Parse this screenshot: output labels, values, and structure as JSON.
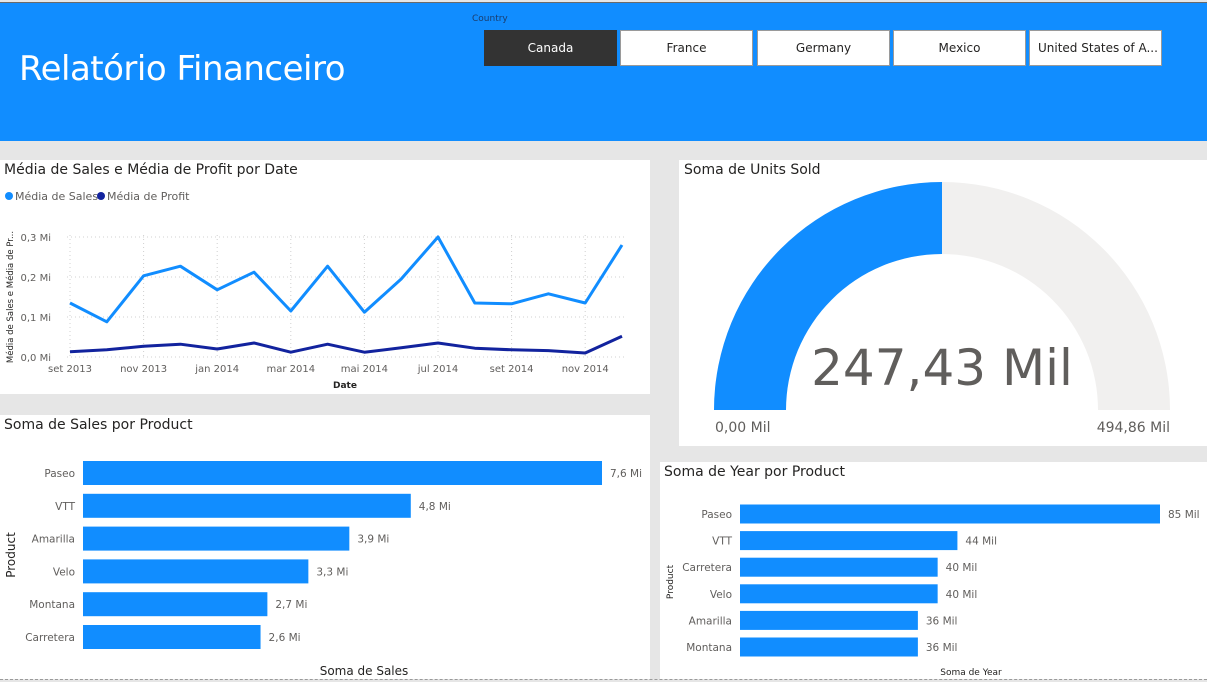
{
  "header": {
    "title": "Relatório Financeiro",
    "slicer_label": "Country",
    "options": [
      {
        "label": "Canada",
        "selected": true
      },
      {
        "label": "France",
        "selected": false
      },
      {
        "label": "Germany",
        "selected": false
      },
      {
        "label": "Mexico",
        "selected": false
      },
      {
        "label": "United States of A...",
        "selected": false
      }
    ]
  },
  "colors": {
    "header_bg": "#118dff",
    "series_sales": "#118dff",
    "series_profit": "#12239e",
    "gauge_fill": "#118dff",
    "gauge_track": "#f1f0ef",
    "selected_button": "#333333"
  },
  "line_panel": {
    "title": "Média de Sales e Média de Profit por Date"
  },
  "gauge_panel": {
    "title": "Soma de Units Sold",
    "value_label": "247,43 Mil",
    "min_label": "0,00 Mil",
    "max_label": "494,86 Mil"
  },
  "sales_panel": {
    "title": "Soma de Sales por Product"
  },
  "year_panel": {
    "title": "Soma de Year por Product"
  },
  "chart_data": [
    {
      "type": "line",
      "title": "Média de Sales e Média de Profit por Date",
      "xlabel": "Date",
      "ylabel": "Média de Sales e Média de Pr...",
      "x": [
        "set 2013",
        "out 2013",
        "nov 2013",
        "dez 2013",
        "jan 2014",
        "fev 2014",
        "mar 2014",
        "abr 2014",
        "mai 2014",
        "jun 2014",
        "jul 2014",
        "ago 2014",
        "set 2014",
        "out 2014",
        "nov 2014",
        "dez 2014"
      ],
      "x_tick_labels": [
        "set 2013",
        "nov 2013",
        "jan 2014",
        "mar 2014",
        "mai 2014",
        "jul 2014",
        "set 2014",
        "nov 2014"
      ],
      "y_tick_labels": [
        "0,0 Mi",
        "0,1 Mi",
        "0,2 Mi",
        "0,3 Mi"
      ],
      "ylim": [
        0,
        0.3
      ],
      "legend_position": "top-left",
      "series": [
        {
          "name": "Média de  Sales",
          "values": [
            0.135,
            0.088,
            0.203,
            0.227,
            0.168,
            0.212,
            0.115,
            0.227,
            0.112,
            0.195,
            0.3,
            0.135,
            0.133,
            0.158,
            0.135,
            0.28
          ]
        },
        {
          "name": "Média de Profit",
          "values": [
            0.013,
            0.018,
            0.027,
            0.032,
            0.02,
            0.035,
            0.012,
            0.032,
            0.012,
            0.023,
            0.035,
            0.022,
            0.018,
            0.016,
            0.01,
            0.052
          ]
        }
      ]
    },
    {
      "type": "gauge",
      "title": "Soma de Units Sold",
      "value": 247.43,
      "min": 0,
      "max": 494.86,
      "unit": "Mil"
    },
    {
      "type": "bar",
      "orientation": "horizontal",
      "title": "Soma de Sales por Product",
      "xlabel": "Soma de Sales",
      "ylabel": "Product",
      "categories": [
        "Paseo",
        "VTT",
        "Amarilla",
        "Velo",
        "Montana",
        "Carretera"
      ],
      "values": [
        7.6,
        4.8,
        3.9,
        3.3,
        2.7,
        2.6
      ],
      "data_labels": [
        "7,6 Mi",
        "4,8 Mi",
        "3,9 Mi",
        "3,3 Mi",
        "2,7 Mi",
        "2,6 Mi"
      ]
    },
    {
      "type": "bar",
      "orientation": "horizontal",
      "title": "Soma de Year por Product",
      "xlabel": "Soma de Year",
      "ylabel": "Product",
      "categories": [
        "Paseo",
        "VTT",
        "Carretera",
        "Velo",
        "Amarilla",
        "Montana"
      ],
      "values": [
        85,
        44,
        40,
        40,
        36,
        36
      ],
      "data_labels": [
        "85 Mil",
        "44 Mil",
        "40 Mil",
        "40 Mil",
        "36 Mil",
        "36 Mil"
      ]
    }
  ]
}
